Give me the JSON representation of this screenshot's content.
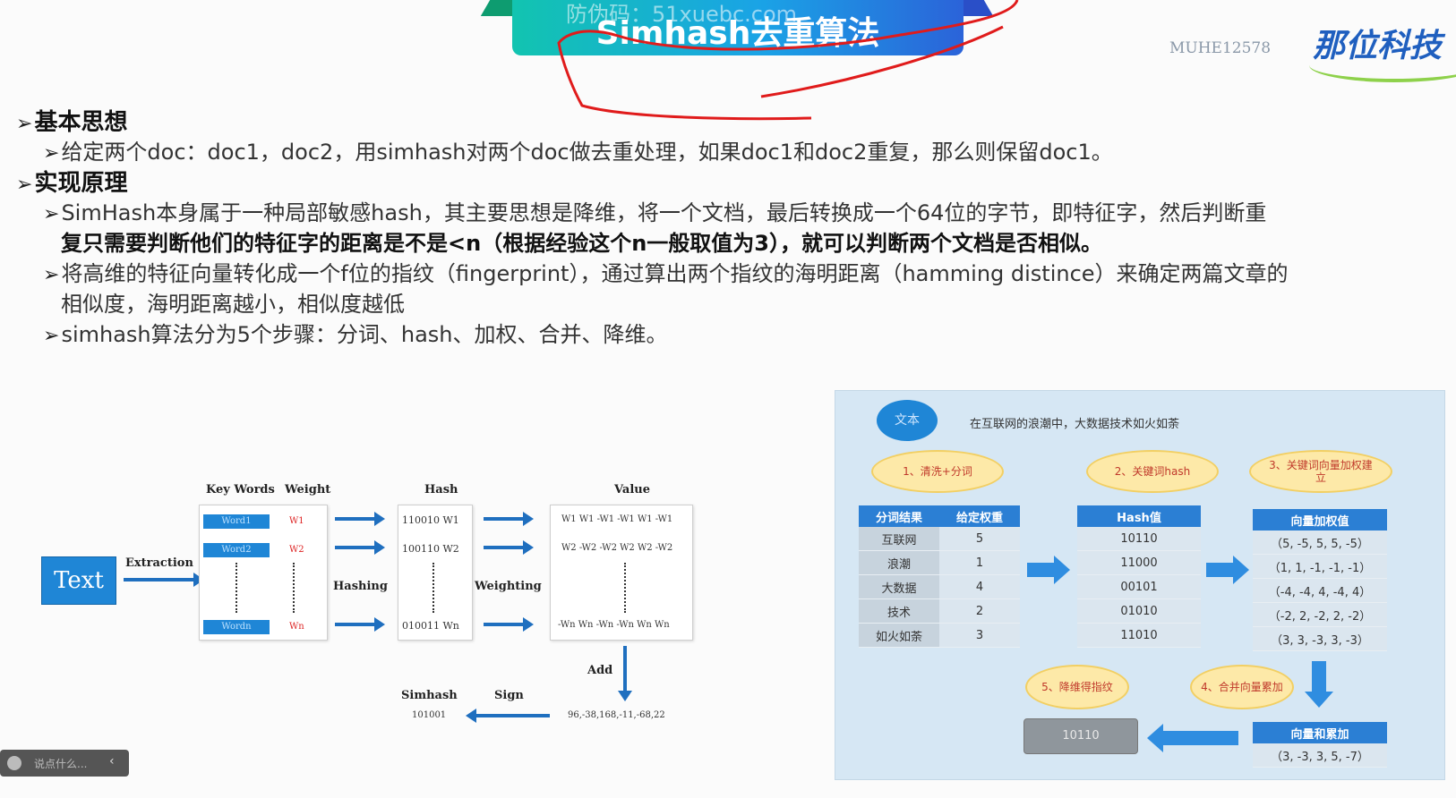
{
  "header": {
    "title": "Simhash去重算法",
    "watermark": "防伪码：51xuebc.com",
    "course_code": "MUHE12578",
    "logo": "那位科技"
  },
  "bullets": {
    "basic_idea": "基本思想",
    "basic_idea_text": "给定两个doc：doc1，doc2，用simhash对两个doc做去重处理，如果doc1和doc2重复，那么则保留doc1。",
    "principle": "实现原理",
    "p1_line1": "SimHash本身属于一种局部敏感hash，其主要思想是降维，将一个文档，最后转换成一个64位的字节，即特征字，然后判断重",
    "p1_line2": "复只需要判断他们的特征字的距离是不是<n（根据经验这个n一般取值为3），就可以判断两个文档是否相似。",
    "p2_line1": "将高维的特征向量转化成一个f位的指纹（fingerprint），通过算出两个指纹的海明距离（hamming distince）来确定两篇文章的",
    "p2_line2": "相似度，海明距离越小，相似度越低",
    "p3": "simhash算法分为5个步骤：分词、hash、加权、合并、降维。"
  },
  "left_diagram": {
    "text_box": "Text",
    "extraction": "Extraction",
    "hashing": "Hashing",
    "weighting": "Weighting",
    "add": "Add",
    "sign": "Sign",
    "col_keywords": "Key Words",
    "col_weight": "Weight",
    "col_hash": "Hash",
    "col_value": "Value",
    "words": [
      "Word1",
      "Word2",
      "Wordn"
    ],
    "weights": [
      "W1",
      "W2",
      "Wn"
    ],
    "hashes": [
      "110010  W1",
      "100110  W2",
      "010011  Wn"
    ],
    "values": [
      "W1 W1 -W1 -W1 W1 -W1",
      "W2 -W2 -W2 W2 W2 -W2",
      "-Wn Wn -Wn -Wn Wn Wn"
    ],
    "sum": "96,-38,168,-11,-68,22",
    "simhash_label": "Simhash",
    "simhash_value": "101001"
  },
  "right_panel": {
    "text_label": "文本",
    "sentence": "在互联网的浪潮中，大数据技术如火如荼",
    "step1": "1、清洗+分词",
    "step2": "2、关键词hash",
    "step3": "3、关键词向量加权建立",
    "step4": "4、合并向量累加",
    "step5": "5、降维得指纹",
    "tbl1_headers": [
      "分词结果",
      "给定权重"
    ],
    "tbl1_rows": [
      [
        "互联网",
        "5"
      ],
      [
        "浪潮",
        "1"
      ],
      [
        "大数据",
        "4"
      ],
      [
        "技术",
        "2"
      ],
      [
        "如火如荼",
        "3"
      ]
    ],
    "tbl2_header": "Hash值",
    "tbl2_rows": [
      "10110",
      "11000",
      "00101",
      "01010",
      "11010"
    ],
    "tbl3_header": "向量加权值",
    "tbl3_rows": [
      "（5, -5, 5, 5, -5）",
      "（1, 1, -1, -1, -1）",
      "（-4, -4, 4, -4, 4）",
      "（-2, 2, -2, 2, -2）",
      "（3, 3, -3, 3, -3）"
    ],
    "sum_header": "向量和累加",
    "sum_value": "（3, -3, 3, 5, -7）",
    "fingerprint": "10110"
  },
  "chat": {
    "placeholder": "说点什么..."
  },
  "colors": {
    "accent": "#1f86d6",
    "pen": "#e01b1b",
    "banner_start": "#12c4b0",
    "banner_end": "#2b63d9"
  }
}
